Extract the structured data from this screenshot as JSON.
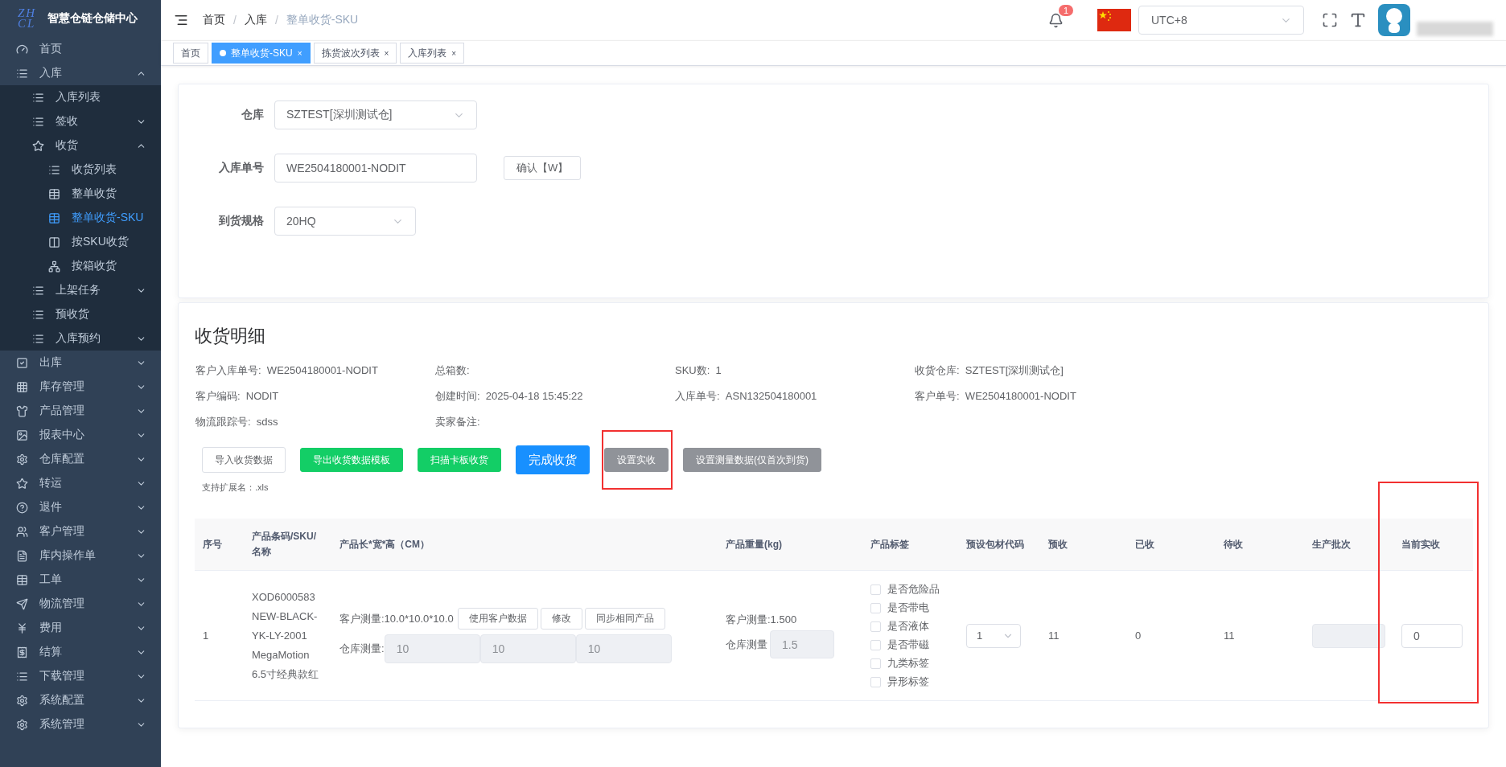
{
  "sidebar": {
    "logo_mark": [
      "ZH",
      "CL"
    ],
    "title": "智慧仓链仓储中心",
    "items": [
      {
        "label": "首页",
        "selected": false
      },
      {
        "label": "入库",
        "selected": false,
        "expanded": true,
        "children": [
          {
            "label": "入库列表",
            "selected": false
          },
          {
            "label": "签收",
            "selected": false,
            "expanded": false
          },
          {
            "label": "收货",
            "selected": false,
            "expanded": true,
            "children": [
              {
                "label": "收货列表",
                "selected": false
              },
              {
                "label": "整单收货",
                "selected": false
              },
              {
                "label": "整单收货-SKU",
                "selected": true
              },
              {
                "label": "按SKU收货",
                "selected": false
              },
              {
                "label": "按箱收货",
                "selected": false
              }
            ]
          },
          {
            "label": "上架任务",
            "selected": false,
            "expanded": false
          },
          {
            "label": "预收货",
            "selected": false
          },
          {
            "label": "入库预约",
            "selected": false,
            "expanded": false
          }
        ]
      },
      {
        "label": "出库",
        "selected": false,
        "expanded": false
      },
      {
        "label": "库存管理",
        "selected": false,
        "expanded": false
      },
      {
        "label": "产品管理",
        "selected": false,
        "expanded": false
      },
      {
        "label": "报表中心",
        "selected": false,
        "expanded": false
      },
      {
        "label": "仓库配置",
        "selected": false,
        "expanded": false
      },
      {
        "label": "转运",
        "selected": false,
        "expanded": false
      },
      {
        "label": "退件",
        "selected": false,
        "expanded": false
      },
      {
        "label": "客户管理",
        "selected": false,
        "expanded": false
      },
      {
        "label": "库内操作单",
        "selected": false,
        "expanded": false
      },
      {
        "label": "工单",
        "selected": false,
        "expanded": false
      },
      {
        "label": "物流管理",
        "selected": false,
        "expanded": false
      },
      {
        "label": "费用",
        "selected": false,
        "expanded": false
      },
      {
        "label": "结算",
        "selected": false,
        "expanded": false
      },
      {
        "label": "下载管理",
        "selected": false,
        "expanded": false
      },
      {
        "label": "系统配置",
        "selected": false,
        "expanded": false
      },
      {
        "label": "系统管理",
        "selected": false,
        "expanded": false
      }
    ]
  },
  "header": {
    "breadcrumb": [
      "首页",
      "入库",
      "整单收货-SKU"
    ],
    "breadcrumb_separator": "/",
    "tab_close_glyph": "×",
    "notification_count": "1",
    "timezone": "UTC+8"
  },
  "tabs": [
    {
      "label": "首页",
      "selected": false,
      "closable": false
    },
    {
      "label": "整单收货-SKU",
      "selected": true,
      "closable": true
    },
    {
      "label": "拣货波次列表",
      "selected": false,
      "closable": true
    },
    {
      "label": "入库列表",
      "selected": false,
      "closable": true
    }
  ],
  "form": {
    "fields": [
      {
        "label": "仓库",
        "kind": "select",
        "value": "SZTEST[深圳测试仓]"
      },
      {
        "label": "入库单号",
        "kind": "input",
        "value": "WE2504180001-NODIT",
        "button": "确认【W】"
      },
      {
        "label": "到货规格",
        "kind": "select",
        "value": "20HQ"
      }
    ]
  },
  "detail": {
    "title": "收货明细",
    "info": [
      {
        "label": "客户入库单号:",
        "value": "WE2504180001-NODIT"
      },
      {
        "label": "总箱数:"
      },
      {
        "label": "SKU数:",
        "value": "1"
      },
      {
        "label": "收货仓库:",
        "value": "SZTEST[深圳测试仓]"
      },
      {
        "label": "客户编码:",
        "value": "NODIT"
      },
      {
        "label": "创建时间:",
        "value": "2025-04-18 15:45:22"
      },
      {
        "label": "入库单号:",
        "value": "ASN132504180001"
      },
      {
        "label": "客户单号:",
        "value": "WE2504180001-NODIT"
      },
      {
        "label": "物流跟踪号:",
        "value": "sdss"
      },
      {
        "label": "卖家备注:"
      }
    ],
    "buttons": [
      {
        "label": "导入收货数据",
        "kind": "outline",
        "highlighted": false
      },
      {
        "label": "导出收货数据模板",
        "kind": "success",
        "highlighted": false
      },
      {
        "label": "扫描卡板收货",
        "kind": "success",
        "highlighted": false
      },
      {
        "label": "完成收货",
        "kind": "primary",
        "highlighted": false
      },
      {
        "label": "设置实收",
        "kind": "muted",
        "highlighted": true
      },
      {
        "label": "设置测量数据(仅首次到货)",
        "kind": "muted",
        "highlighted": false
      }
    ],
    "upload_hint": "支持扩展名：.xls"
  },
  "table": {
    "columns": [
      {
        "label": "序号",
        "highlighted": false
      },
      {
        "label": "产品条码/SKU/名称",
        "highlighted": false
      },
      {
        "label": "产品长*宽*高（CM）",
        "highlighted": false
      },
      {
        "label": "产品重量(kg)",
        "highlighted": false
      },
      {
        "label": "产品标签",
        "highlighted": false
      },
      {
        "label": "预设包材代码",
        "highlighted": false
      },
      {
        "label": "预收",
        "highlighted": false
      },
      {
        "label": "已收",
        "highlighted": false
      },
      {
        "label": "待收",
        "highlighted": false
      },
      {
        "label": "生产批次",
        "highlighted": false
      },
      {
        "label": "当前实收",
        "highlighted": true
      }
    ],
    "rows": [
      {
        "index": "1",
        "product_lines": [
          "XOD6000583",
          "NEW-BLACK-",
          "YK-LY-2001",
          "MegaMotion",
          "6.5寸经典款红"
        ],
        "customer_size": "客户测量:10.0*10.0*10.0",
        "size_buttons": [
          "使用客户数据",
          "修改",
          "同步相同产品"
        ],
        "warehouse_size_label": "仓库测量:",
        "warehouse_size": [
          {
            "value": "10",
            "disabled": true
          },
          {
            "value": "10",
            "disabled": true
          },
          {
            "value": "10",
            "disabled": true
          }
        ],
        "customer_weight": "客户测量:1.500",
        "warehouse_weight_label": "仓库测量",
        "warehouse_weight": {
          "value": "1.5",
          "disabled": true
        },
        "tags": [
          {
            "label": "是否危险品",
            "checked": false
          },
          {
            "label": "是否带电",
            "checked": false
          },
          {
            "label": "是否液体",
            "checked": false
          },
          {
            "label": "是否带磁",
            "checked": false
          },
          {
            "label": "九类标签",
            "checked": false
          },
          {
            "label": "异形标签",
            "checked": false
          }
        ],
        "package_code": "1",
        "expected": "11",
        "received": "0",
        "pending": "11",
        "batch": {
          "disabled": true
        },
        "current": {
          "value": "0",
          "disabled": false
        }
      }
    ]
  }
}
